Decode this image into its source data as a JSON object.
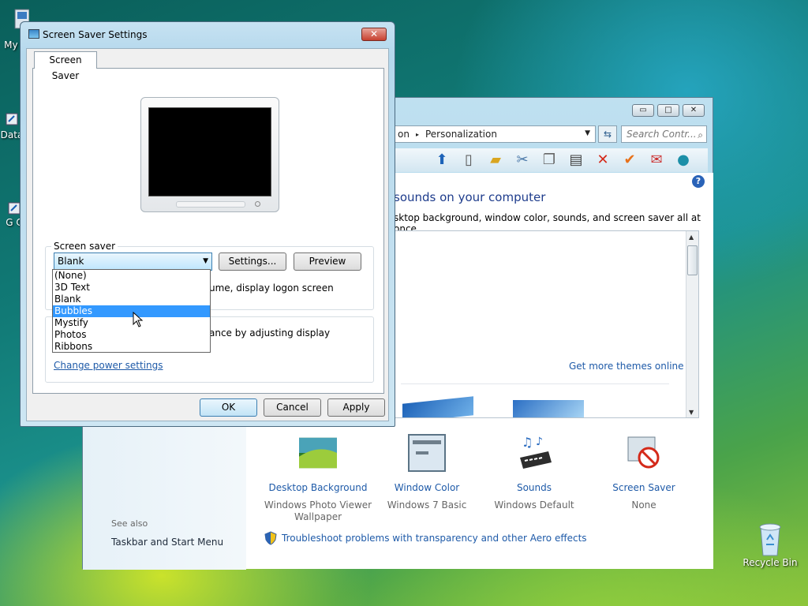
{
  "desktop": {
    "icons": [
      {
        "label": "My C",
        "icon": "computer-icon"
      },
      {
        "label": "Data",
        "icon": "shortcut-icon"
      },
      {
        "label": "G C",
        "icon": "shortcut-icon"
      },
      {
        "label": "Recycle Bin",
        "icon": "recycle-bin-icon"
      }
    ]
  },
  "control_panel": {
    "address": {
      "prefix": "on",
      "separator": "▸",
      "location": "Personalization"
    },
    "search_placeholder": "Search Contr...",
    "heading": "sounds on your computer",
    "description": "sktop background, window color, sounds, and screen saver all at once.",
    "more_themes_link": "Get more themes online",
    "items": [
      {
        "link": "Desktop Background",
        "sub": "Windows Photo Viewer Wallpaper",
        "icon": "desktop-background-icon"
      },
      {
        "link": "Window Color",
        "sub": "Windows 7 Basic",
        "icon": "window-color-icon"
      },
      {
        "link": "Sounds",
        "sub": "Windows Default",
        "icon": "sounds-icon"
      },
      {
        "link": "Screen Saver",
        "sub": "None",
        "icon": "screen-saver-icon"
      }
    ],
    "see_also_label": "See also",
    "see_also_link": "Taskbar and Start Menu",
    "troubleshoot_link": "Troubleshoot problems with transparency and other Aero effects",
    "help_glyph": "?"
  },
  "dialog": {
    "title": "Screen Saver Settings",
    "close_glyph": "✕",
    "tab": "Screen Saver",
    "group_label": "Screen saver",
    "selected": "Blank",
    "settings_button": "Settings...",
    "preview_button": "Preview",
    "logon_text": "ume, display logon screen",
    "energy_text": "ance by adjusting display",
    "power_link": "Change power settings",
    "options": [
      "(None)",
      "3D Text",
      "Blank",
      "Bubbles",
      "Mystify",
      "Photos",
      "Ribbons"
    ],
    "highlighted_option": "Bubbles",
    "ok": "OK",
    "cancel": "Cancel",
    "apply": "Apply"
  },
  "colors": {
    "link": "#1e5aa8",
    "highlight": "#3399ff"
  }
}
